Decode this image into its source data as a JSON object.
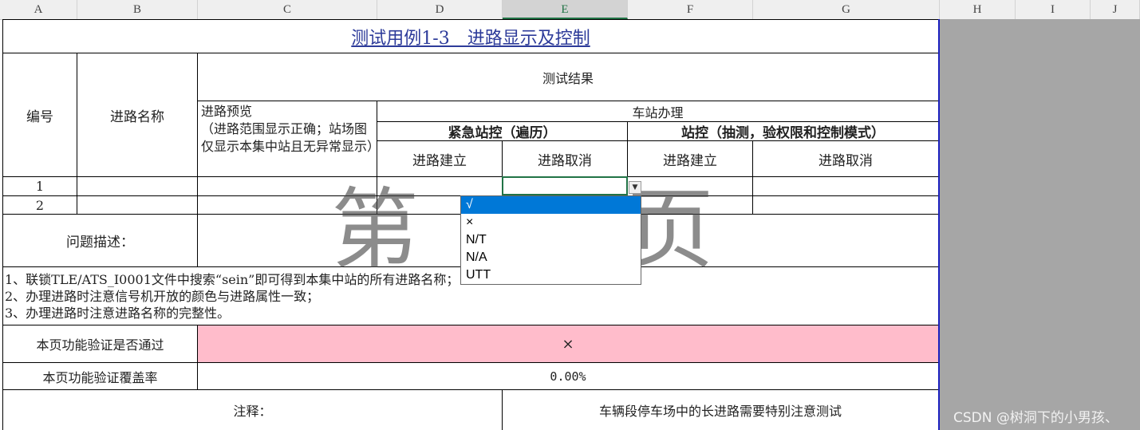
{
  "columns": [
    "A",
    "B",
    "C",
    "D",
    "E",
    "F",
    "G",
    "H",
    "I",
    "J"
  ],
  "selected_column": "E",
  "title": "测试用例1-3　进路显示及控制",
  "header": {
    "id": "编号",
    "route_name": "进路名称",
    "test_result": "测试结果",
    "route_preview": "进路预览\n（进路范围显示正确；站场图仅显示本集中站且无异常显示）",
    "station_handling": "车站办理",
    "emergency_control": "紧急站控（遍历）",
    "station_control": "站控（抽测，验权限和控制模式）",
    "route_build_1": "进路建立",
    "route_cancel_1": "进路取消",
    "route_build_2": "进路建立",
    "route_cancel_2": "进路取消"
  },
  "rows": [
    {
      "id": "1"
    },
    {
      "id": "2"
    }
  ],
  "problem_label": "问题描述：",
  "notes_lines": [
    "1、联锁TLE/ATS_I0001文件中搜索“sein”即可得到本集中站的所有进路名称；",
    "2、办理进路时注意信号机开放的颜色与进路属性一致；",
    "3、办理进路时注意进路名称的完整性。"
  ],
  "pass_label": "本页功能验证是否通过",
  "pass_value": "×",
  "coverage_label": "本页功能验证覆盖率",
  "coverage_value": "0.00%",
  "remark_label": "注释：",
  "remark_value": "车辆段停车场中的长进路需要特别注意测试",
  "watermark": "第 1 页",
  "dropdown": {
    "options": [
      "√",
      "×",
      "N/T",
      "N/A",
      "UTT"
    ],
    "selected_index": 0
  },
  "footer_watermark": "CSDN @树洞下的小男孩、",
  "colors": {
    "pink": "#ffbccb",
    "selection_blue": "#0078d7",
    "excel_green": "#217346",
    "title_blue": "#2d3b9a"
  }
}
